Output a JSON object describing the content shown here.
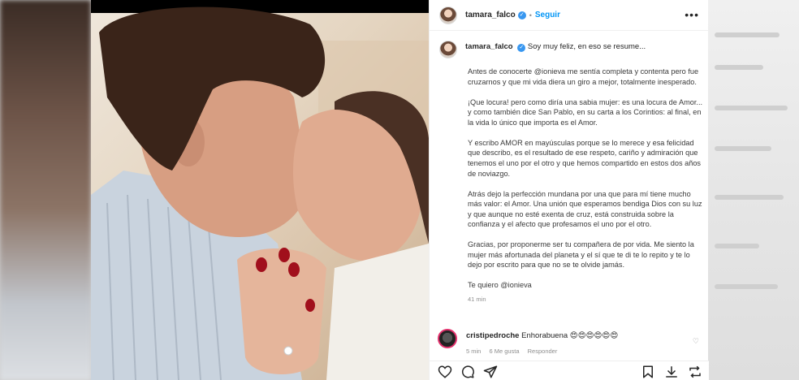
{
  "header": {
    "username": "tamara_falco",
    "separator": "•",
    "follow_label": "Seguir",
    "more_label": "•••"
  },
  "caption": {
    "username": "tamara_falco",
    "first_line": "Soy muy feliz, en eso se resume...",
    "paragraphs": [
      "Antes de conocerte @ionieva me sentía completa y contenta pero fue cruzarnos y que mi vida diera un giro a mejor, totalmente inesperado.",
      "¡Que locura! pero como diría una sabia mujer: es una locura de Amor... y como también dice San Pablo, en su carta a los Corintios: al final, en la vida lo único que importa es el Amor.",
      "Y escribo AMOR en mayúsculas porque se lo merece y esa felicidad que describo, es el resultado de ese respeto, cariño y admiración que tenemos el uno por el otro y que hemos compartido en estos dos años de noviazgo.",
      "Atrás dejo la perfección mundana por una que para mí tiene mucho más valor: el Amor. Una unión que esperamos bendiga Dios con su luz y que aunque no esté exenta de cruz, está construida sobre la confianza y el afecto que profesamos el uno por el otro.",
      "Gracias, por proponerme ser tu compañera de por vida. Me siento la mujer más afortunada del planeta y el sí que te di te lo repito y te lo dejo por escrito para que no se te olvide jamás.",
      "Te quiero @ionieva"
    ],
    "time": "41 min"
  },
  "comment": {
    "username": "cristipedroche",
    "text": "Enhorabuena 😍😍😍😍😍😍",
    "time": "5 min",
    "likes": "6 Me gusta",
    "reply": "Responder"
  },
  "colors": {
    "link_blue": "#0095f6",
    "verified_blue": "#3897f0",
    "text_dark": "#262626",
    "text_muted": "#8e8e8e"
  },
  "icons": [
    "heart-icon",
    "comment-icon",
    "share-icon",
    "save-icon",
    "download-icon",
    "retweet-icon"
  ]
}
